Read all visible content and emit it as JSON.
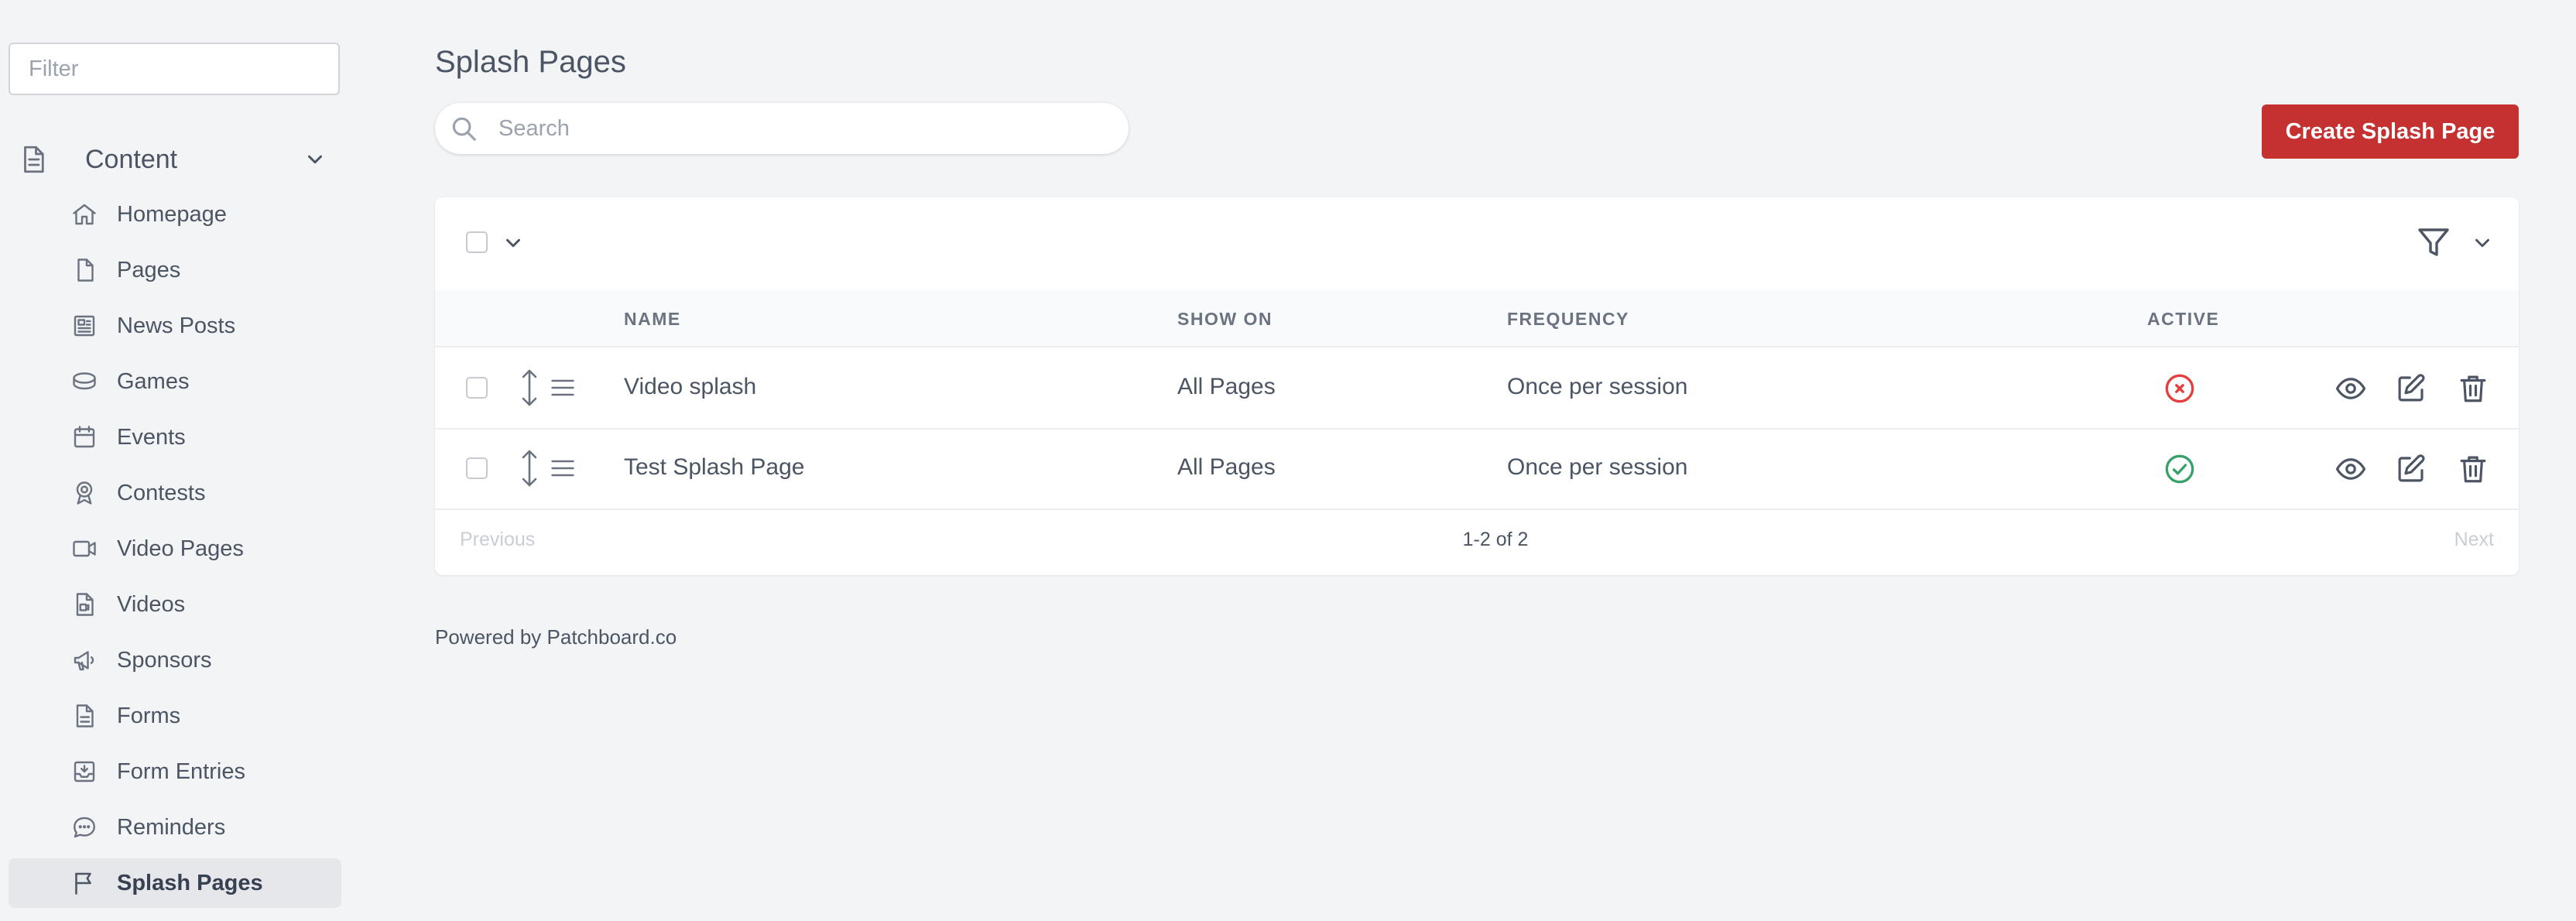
{
  "sidebar": {
    "filter_placeholder": "Filter",
    "section_title": "Content",
    "items": [
      {
        "label": "Homepage",
        "icon": "home-icon"
      },
      {
        "label": "Pages",
        "icon": "file-icon"
      },
      {
        "label": "News Posts",
        "icon": "newspaper-icon"
      },
      {
        "label": "Games",
        "icon": "database-icon"
      },
      {
        "label": "Events",
        "icon": "calendar-icon"
      },
      {
        "label": "Contests",
        "icon": "badge-icon"
      },
      {
        "label": "Video Pages",
        "icon": "video-camera-icon"
      },
      {
        "label": "Videos",
        "icon": "video-file-icon"
      },
      {
        "label": "Sponsors",
        "icon": "megaphone-icon"
      },
      {
        "label": "Forms",
        "icon": "document-text-icon"
      },
      {
        "label": "Form Entries",
        "icon": "inbox-icon"
      },
      {
        "label": "Reminders",
        "icon": "chat-icon"
      },
      {
        "label": "Splash Pages",
        "icon": "flag-icon",
        "active": true
      }
    ]
  },
  "main": {
    "title": "Splash Pages",
    "search_placeholder": "Search",
    "create_button": "Create Splash Page",
    "table": {
      "columns": {
        "name": "NAME",
        "show_on": "SHOW ON",
        "frequency": "FREQUENCY",
        "active": "ACTIVE"
      },
      "rows": [
        {
          "name": "Video splash",
          "show_on": "All Pages",
          "frequency": "Once per session",
          "active": false
        },
        {
          "name": "Test Splash Page",
          "show_on": "All Pages",
          "frequency": "Once per session",
          "active": true
        }
      ]
    },
    "pagination": {
      "previous": "Previous",
      "info": "1-2 of 2",
      "next": "Next"
    },
    "footer": "Powered by Patchboard.co"
  },
  "colors": {
    "accent": "#c53030",
    "active_true": "#38a169",
    "active_false": "#e53e3e",
    "icon_gray": "#6b7280"
  }
}
